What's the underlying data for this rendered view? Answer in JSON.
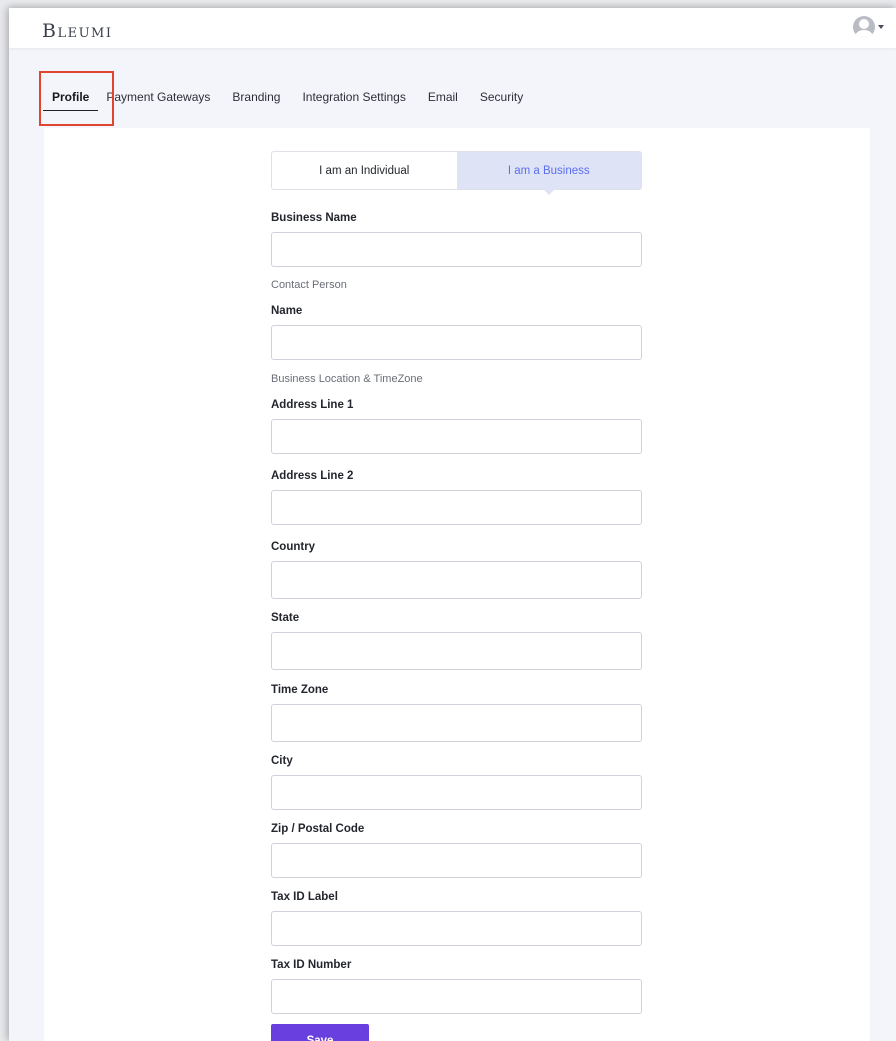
{
  "app": {
    "logo": "Bleumi",
    "avatar_icon": "user-avatar-icon"
  },
  "tabs": [
    {
      "label": "Profile",
      "active": true
    },
    {
      "label": "Payment Gateways",
      "active": false
    },
    {
      "label": "Branding",
      "active": false
    },
    {
      "label": "Integration Settings",
      "active": false
    },
    {
      "label": "Email",
      "active": false
    },
    {
      "label": "Security",
      "active": false
    }
  ],
  "account_type": {
    "individual_label": "I am an Individual",
    "business_label": "I am a Business",
    "selected": "business"
  },
  "form": {
    "business_name_label": "Business Name",
    "business_name_value": "",
    "contact_section": "Contact Person",
    "name_label": "Name",
    "name_value": "",
    "location_section": "Business Location & TimeZone",
    "address1_label": "Address Line 1",
    "address1_value": "",
    "address2_label": "Address Line 2",
    "address2_value": "",
    "country_label": "Country",
    "country_value": "",
    "state_label": "State",
    "state_value": "",
    "timezone_label": "Time Zone",
    "timezone_value": "",
    "city_label": "City",
    "city_value": "",
    "zip_label": "Zip / Postal Code",
    "zip_value": "",
    "taxid_label_label": "Tax ID Label",
    "taxid_label_value": "",
    "taxid_number_label": "Tax ID Number",
    "taxid_number_value": "",
    "save_label": "Save\nChanges"
  },
  "colors": {
    "accent": "#6a3fe0",
    "selected_toggle_bg": "#dfe3f6",
    "selected_toggle_text": "#5a6ef0",
    "highlight_box": "#e0452d"
  }
}
